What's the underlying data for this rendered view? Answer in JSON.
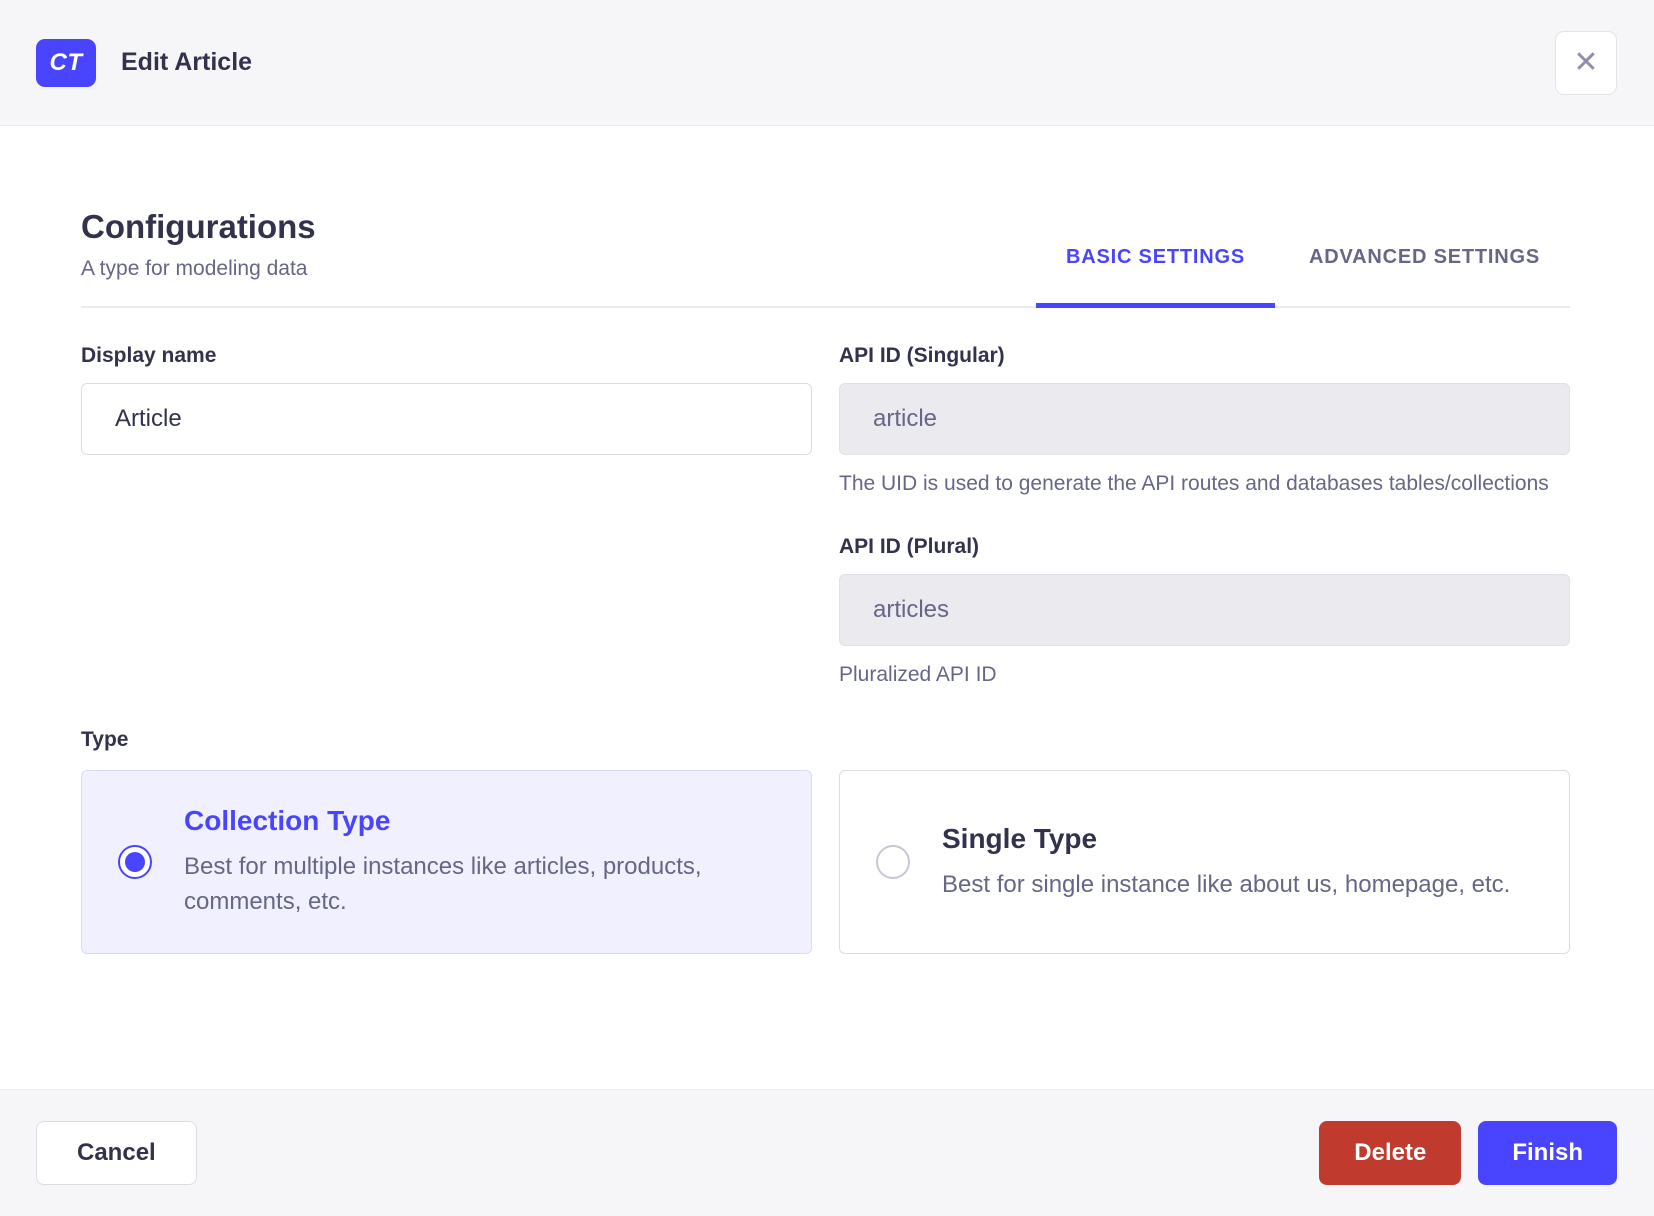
{
  "header": {
    "badge": "CT",
    "title": "Edit Article",
    "close_icon": "✕"
  },
  "intro": {
    "title": "Configurations",
    "subtitle": "A type for modeling data"
  },
  "tabs": {
    "items": [
      {
        "label": "BASIC SETTINGS",
        "active": true
      },
      {
        "label": "ADVANCED SETTINGS",
        "active": false
      }
    ]
  },
  "form": {
    "display_name": {
      "label": "Display name",
      "value": "Article"
    },
    "api_id_singular": {
      "label": "API ID (Singular)",
      "value": "article",
      "hint": "The UID is used to generate the API routes and databases tables/collections"
    },
    "api_id_plural": {
      "label": "API ID (Plural)",
      "value": "articles",
      "hint": "Pluralized API ID"
    },
    "type": {
      "label": "Type",
      "options": [
        {
          "title": "Collection Type",
          "description": "Best for multiple instances like articles, products, comments, etc.",
          "selected": true
        },
        {
          "title": "Single Type",
          "description": "Best for single instance like about us, homepage, etc.",
          "selected": false
        }
      ]
    }
  },
  "footer": {
    "cancel": "Cancel",
    "delete": "Delete",
    "finish": "Finish"
  },
  "colors": {
    "primary": "#4945ff",
    "danger": "#c13a2e",
    "text_dark": "#32324d",
    "text_muted": "#666687",
    "surface_gray": "#f6f6f9",
    "selected_card_bg": "#f0f0ff"
  }
}
